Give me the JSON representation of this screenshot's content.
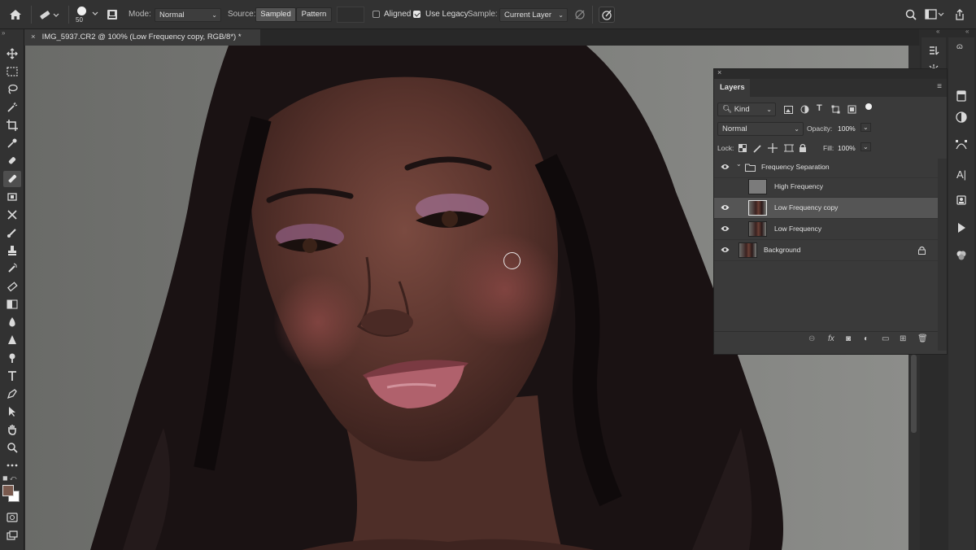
{
  "options_bar": {
    "brush_size": "50",
    "mode_label": "Mode:",
    "mode_value": "Normal",
    "source_label": "Source:",
    "source_sampled": "Sampled",
    "source_pattern": "Pattern",
    "aligned_label": "Aligned",
    "aligned_checked": false,
    "use_legacy_label": "Use Legacy",
    "use_legacy_checked": true,
    "sample_label": "Sample:",
    "sample_value": "Current Layer"
  },
  "document": {
    "tab_title": "IMG_5937.CR2 @ 100% (Low Frequency copy, RGB/8*) *"
  },
  "toolbar": {
    "tools": [
      "move-tool-icon",
      "marquee-tool-icon",
      "lasso-tool-icon",
      "magic-wand-icon",
      "crop-tool-icon",
      "eyedropper-icon",
      "spot-healing-icon",
      "healing-brush-icon",
      "patch-tool-icon",
      "content-aware-move-icon",
      "brush-tool-icon",
      "clone-stamp-icon",
      "history-brush-icon",
      "eraser-icon",
      "gradient-icon",
      "blur-icon",
      "dodge-icon",
      "pen-tool-icon",
      "type-tool-icon",
      "path-selection-icon",
      "direct-selection-icon",
      "hand-tool-icon",
      "zoom-tool-icon",
      "more-tools-icon"
    ],
    "foreground_color": "#7a5a4e",
    "background_color": "#ffffff"
  },
  "layers_panel": {
    "tab_label": "Layers",
    "kind_label": "Kind",
    "blend_mode": "Normal",
    "opacity_label": "Opacity:",
    "opacity_value": "100%",
    "lock_label": "Lock:",
    "fill_label": "Fill:",
    "fill_value": "100%",
    "layers": [
      {
        "name": "Frequency Separation",
        "type": "group",
        "visible": true,
        "expanded": true
      },
      {
        "name": "High Frequency",
        "type": "layer",
        "visible": false,
        "thumb": "gray",
        "indent": true
      },
      {
        "name": "Low Frequency copy",
        "type": "layer",
        "visible": true,
        "thumb": "portrait",
        "indent": true,
        "selected": true
      },
      {
        "name": "Low Frequency",
        "type": "layer",
        "visible": true,
        "thumb": "portrait",
        "indent": true
      },
      {
        "name": "Background",
        "type": "layer",
        "visible": true,
        "thumb": "portrait",
        "locked": true
      }
    ]
  },
  "colors": {
    "ui_bg": "#323232",
    "panel_bg": "#3a3a3a",
    "selected_layer": "#555555"
  }
}
